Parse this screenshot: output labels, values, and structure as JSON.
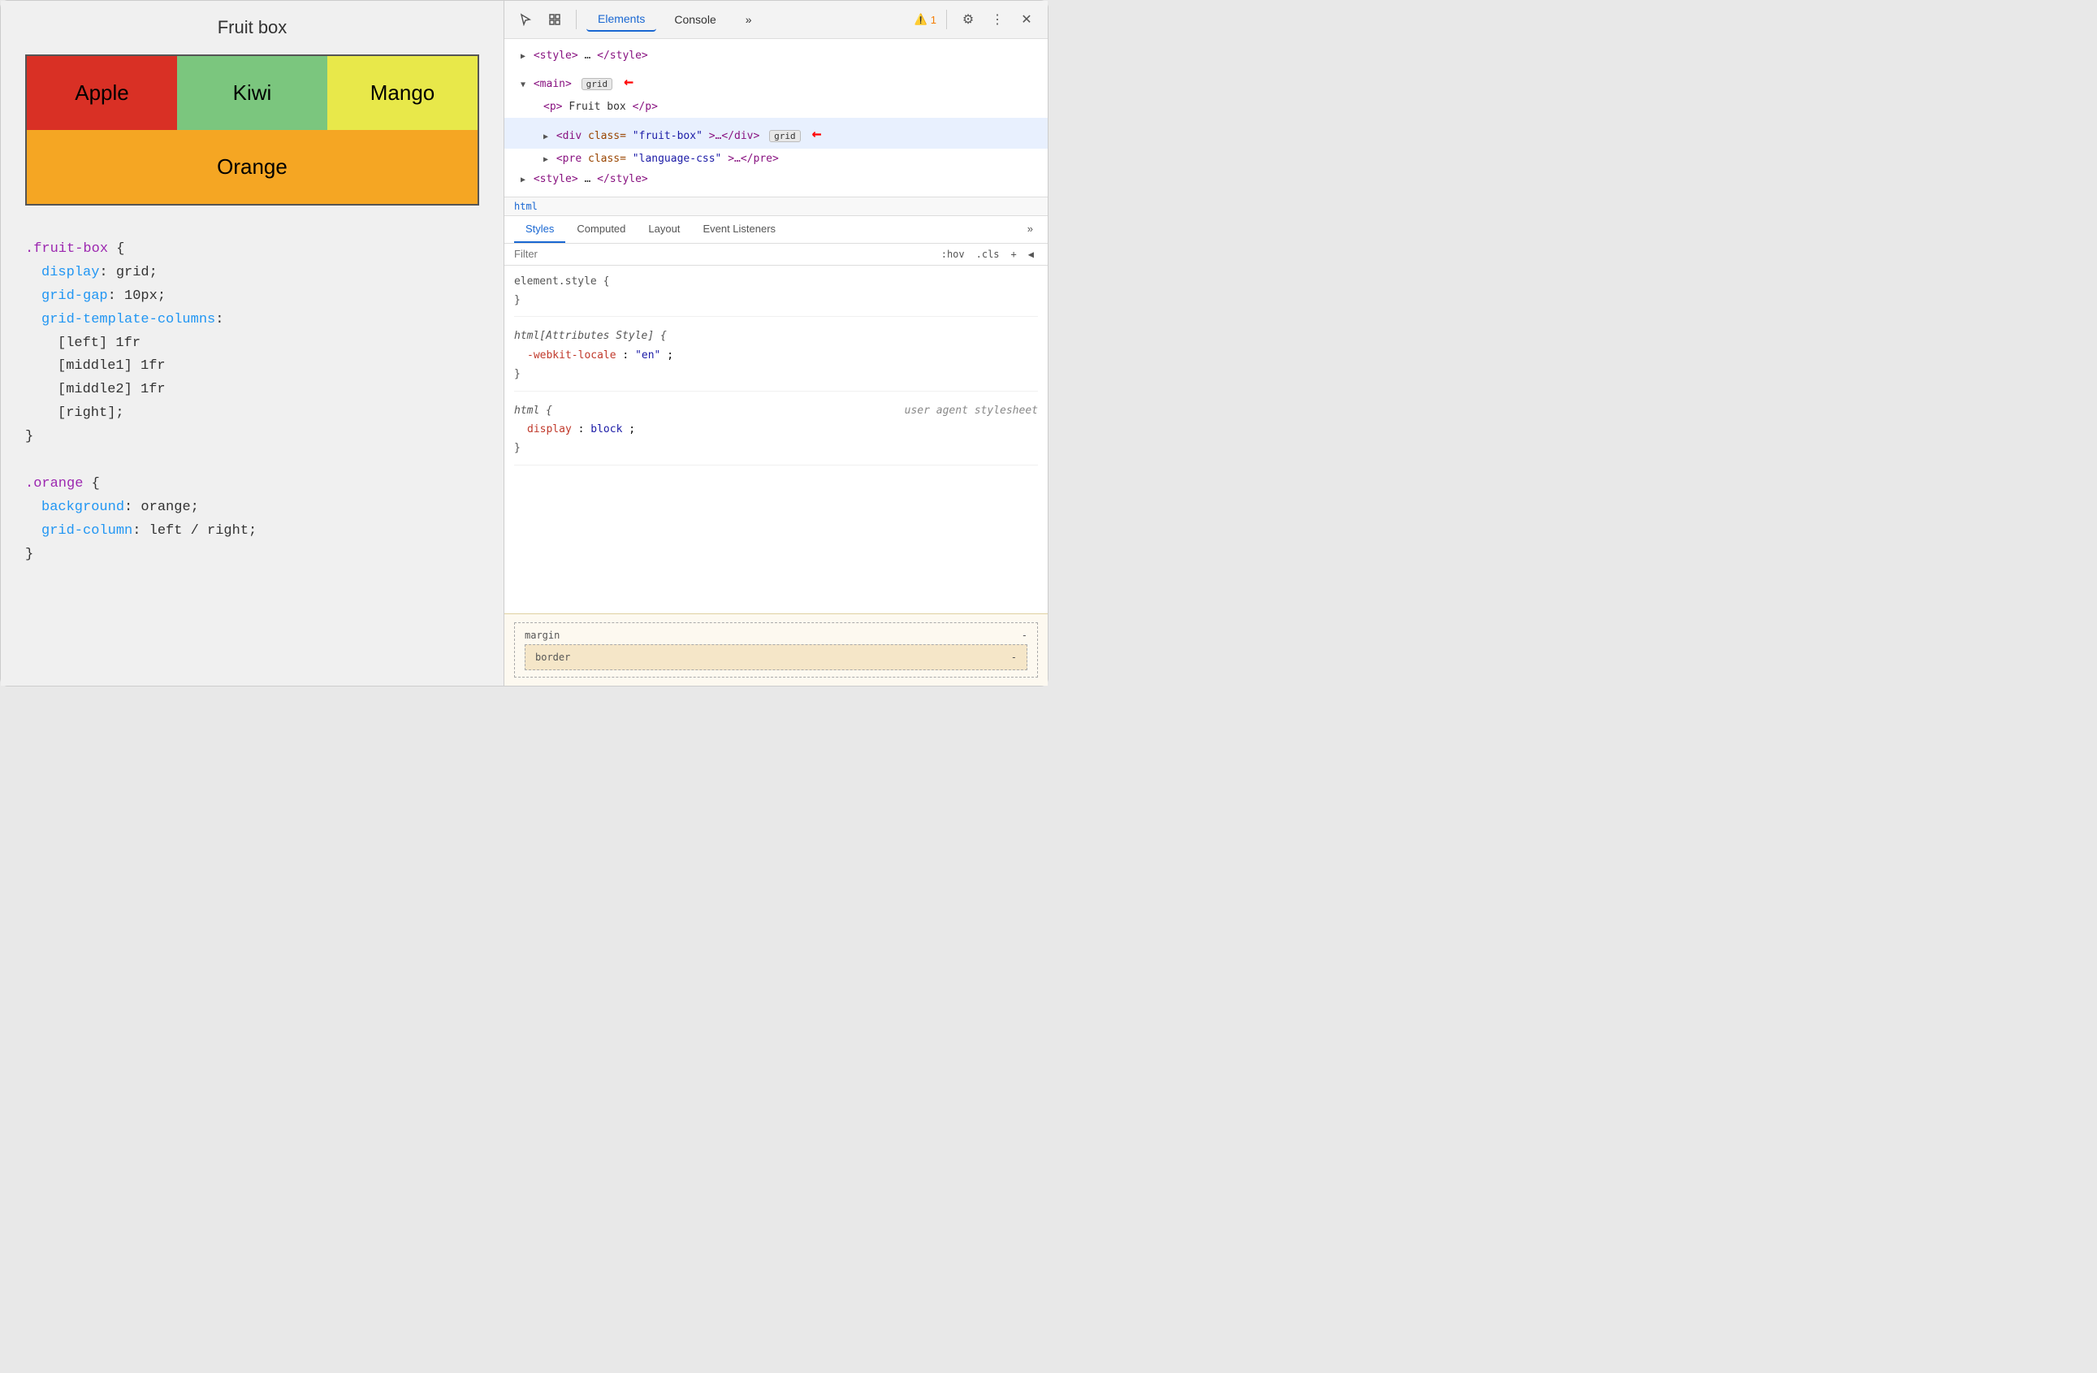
{
  "left": {
    "title": "Fruit box",
    "fruits": [
      {
        "label": "Apple",
        "class": "apple-cell"
      },
      {
        "label": "Kiwi",
        "class": "kiwi-cell"
      },
      {
        "label": "Mango",
        "class": "mango-cell"
      },
      {
        "label": "Orange",
        "class": "orange-cell"
      }
    ],
    "code_lines": [
      {
        "indent": 0,
        "type": "selector",
        "text": ".fruit-box {"
      },
      {
        "indent": 1,
        "type": "property",
        "prop": "display",
        "value": ": grid;"
      },
      {
        "indent": 1,
        "type": "property",
        "prop": "grid-gap",
        "value": ": 10px;"
      },
      {
        "indent": 1,
        "type": "property-highlight",
        "prop": "grid-template-columns",
        "value": ":"
      },
      {
        "indent": 2,
        "type": "value",
        "text": "[left] 1fr"
      },
      {
        "indent": 2,
        "type": "value",
        "text": "[middle1] 1fr"
      },
      {
        "indent": 2,
        "type": "value",
        "text": "[middle2] 1fr"
      },
      {
        "indent": 2,
        "type": "value",
        "text": "[right];"
      },
      {
        "indent": 0,
        "type": "brace",
        "text": "}"
      },
      {
        "indent": 0,
        "type": "empty",
        "text": ""
      },
      {
        "indent": 0,
        "type": "selector",
        "text": ".orange {"
      },
      {
        "indent": 1,
        "type": "property",
        "prop": "background",
        "value": ": orange;"
      },
      {
        "indent": 1,
        "type": "property",
        "prop": "grid-column",
        "value": ": left / right;"
      },
      {
        "indent": 0,
        "type": "brace",
        "text": "}"
      }
    ]
  },
  "devtools": {
    "tabs": [
      "Elements",
      "Console",
      "»"
    ],
    "active_tab": "Elements",
    "warning_count": "1",
    "dom_tree": [
      {
        "indent": 0,
        "content": "▶ <style>…</style>",
        "type": "collapsed"
      },
      {
        "indent": 0,
        "content": "▼ <main>",
        "badge": "grid",
        "arrow": true,
        "type": "expanded",
        "selected": false
      },
      {
        "indent": 1,
        "content": "<p>Fruit box</p>",
        "type": "leaf"
      },
      {
        "indent": 1,
        "content": "▶ <div class=\"fruit-box\">…</div>",
        "badge": "grid",
        "arrow": true,
        "type": "collapsed",
        "selected": true
      },
      {
        "indent": 1,
        "content": "▶ <pre class=\"language-css\">…</pre>",
        "type": "collapsed"
      },
      {
        "indent": 0,
        "content": "▶ <style>…</style>",
        "type": "collapsed"
      }
    ],
    "breadcrumb": "html",
    "styles_tabs": [
      "Styles",
      "Computed",
      "Layout",
      "Event Listeners",
      "»"
    ],
    "active_styles_tab": "Styles",
    "filter_placeholder": "Filter",
    "filter_actions": [
      ":hov",
      ".cls",
      "+",
      "◀"
    ],
    "css_rules": [
      {
        "selector": "element.style {",
        "props": [],
        "close": "}"
      },
      {
        "selector": "html[Attributes Style] {",
        "props": [
          {
            "name": "-webkit-locale",
            "value": "\"en\""
          }
        ],
        "close": "}"
      },
      {
        "selector": "html {",
        "comment": "user agent stylesheet",
        "props": [
          {
            "name": "display",
            "value": "block"
          }
        ],
        "close": "}",
        "italic": true
      }
    ],
    "box_model": {
      "margin_label": "margin",
      "margin_value": "-",
      "border_label": "border",
      "border_value": "-"
    }
  }
}
